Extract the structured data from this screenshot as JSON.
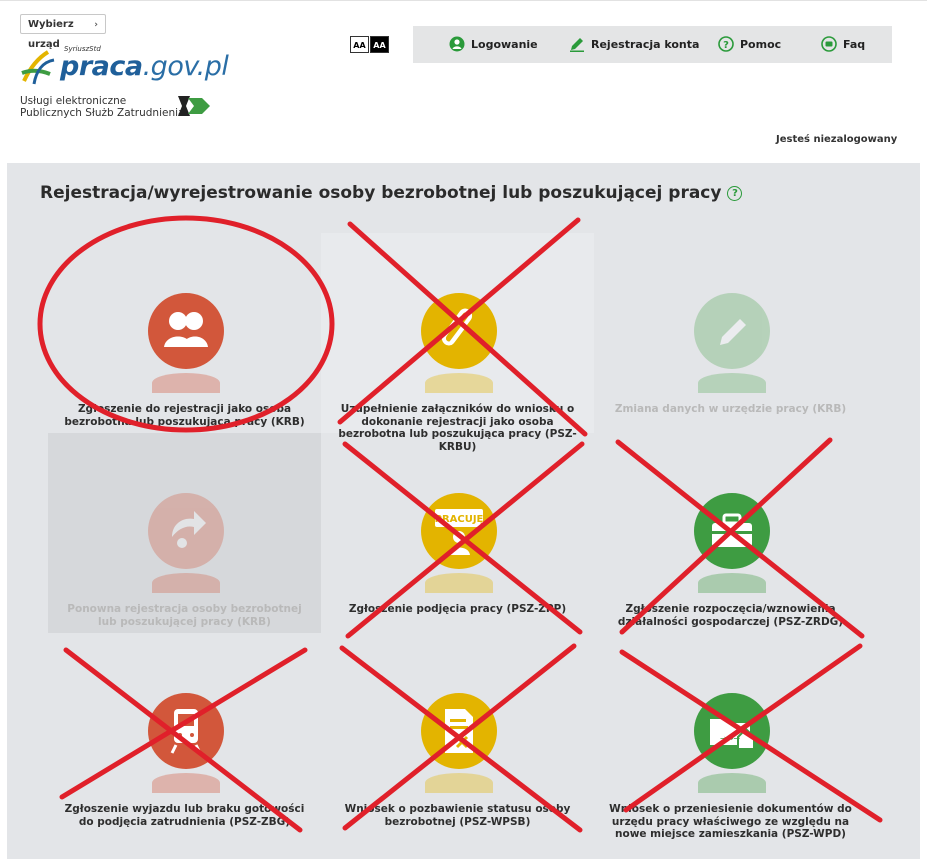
{
  "header": {
    "office_select_label": "Wybierz urząd",
    "logo_brand": "praca",
    "logo_domain": ".gov.pl",
    "logo_superscript": "SyriuszStd",
    "services_line1": "Usługi elektroniczne",
    "services_line2": "Publicznych Służb Zatrudnienia",
    "font_small": "AA",
    "font_large": "AA",
    "status": "Jesteś niezalogowany"
  },
  "nav": [
    {
      "label": "Logowanie",
      "icon": "user-icon"
    },
    {
      "label": "Rejestracja konta",
      "icon": "pencil-icon"
    },
    {
      "label": "Pomoc",
      "icon": "question-icon"
    },
    {
      "label": "Faq",
      "icon": "chat-icon"
    }
  ],
  "main": {
    "title": "Rejestracja/wyrejestrowanie osoby bezrobotnej lub poszukującej pracy",
    "help_symbol": "?"
  },
  "tiles": [
    {
      "label": "Zgłoszenie do rejestracji jako osoba bezrobotna lub poszukująca pracy (KRB)",
      "icon": "people-icon",
      "color": "#d2573b",
      "disabled": false,
      "crossed": false,
      "circled": true
    },
    {
      "label": "Uzupełnienie załączników do wniosku o dokonanie rejestracji jako osoba bezrobotna lub poszukująca pracy (PSZ-KRBU)",
      "icon": "paperclip-icon",
      "color": "#e3b400",
      "disabled": false,
      "crossed": true,
      "circled": false
    },
    {
      "label": "Zmiana danych w urzędzie pracy (KRB)",
      "icon": "pencil-icon",
      "color": "#4ea54e",
      "disabled": true,
      "crossed": false,
      "circled": false
    },
    {
      "label": "Ponowna rejestracja osoby bezrobotnej lub poszukującej pracy (KRB)",
      "icon": "return-user-icon",
      "color": "#d2573b",
      "disabled": true,
      "crossed": false,
      "circled": false
    },
    {
      "label": "Zgłoszenie podjęcia pracy (PSZ-ZPP)",
      "icon": "job-sign-icon",
      "icon_text": "PRACUJĘ",
      "color": "#e3b400",
      "disabled": false,
      "crossed": true,
      "circled": false
    },
    {
      "label": "Zgłoszenie rozpoczęcia/wznowienia działalności gospodarczej (PSZ-ZRDG)",
      "icon": "briefcase-icon",
      "color": "#3e9c42",
      "disabled": false,
      "crossed": true,
      "circled": false
    },
    {
      "label": "Zgłoszenie wyjazdu lub braku gotowości do podjęcia zatrudnienia (PSZ-ZBG)",
      "icon": "train-icon",
      "color": "#d2573b",
      "disabled": false,
      "crossed": true,
      "circled": false
    },
    {
      "label": "Wniosek o pozbawienie statusu osoby bezrobotnej (PSZ-WPSB)",
      "icon": "document-x-icon",
      "color": "#e3b400",
      "disabled": false,
      "crossed": true,
      "circled": false
    },
    {
      "label": "Wniosek o przeniesienie dokumentów do urzędu pracy właściwego ze względu na nowe miejsce zamieszkania (PSZ-WPD)",
      "icon": "folder-house-icon",
      "color": "#3e9c42",
      "disabled": false,
      "crossed": true,
      "circled": false
    }
  ],
  "colors": {
    "annotation": "#e0202a",
    "panel": "#e3e5e8",
    "nav_green": "#2a9a3a"
  }
}
